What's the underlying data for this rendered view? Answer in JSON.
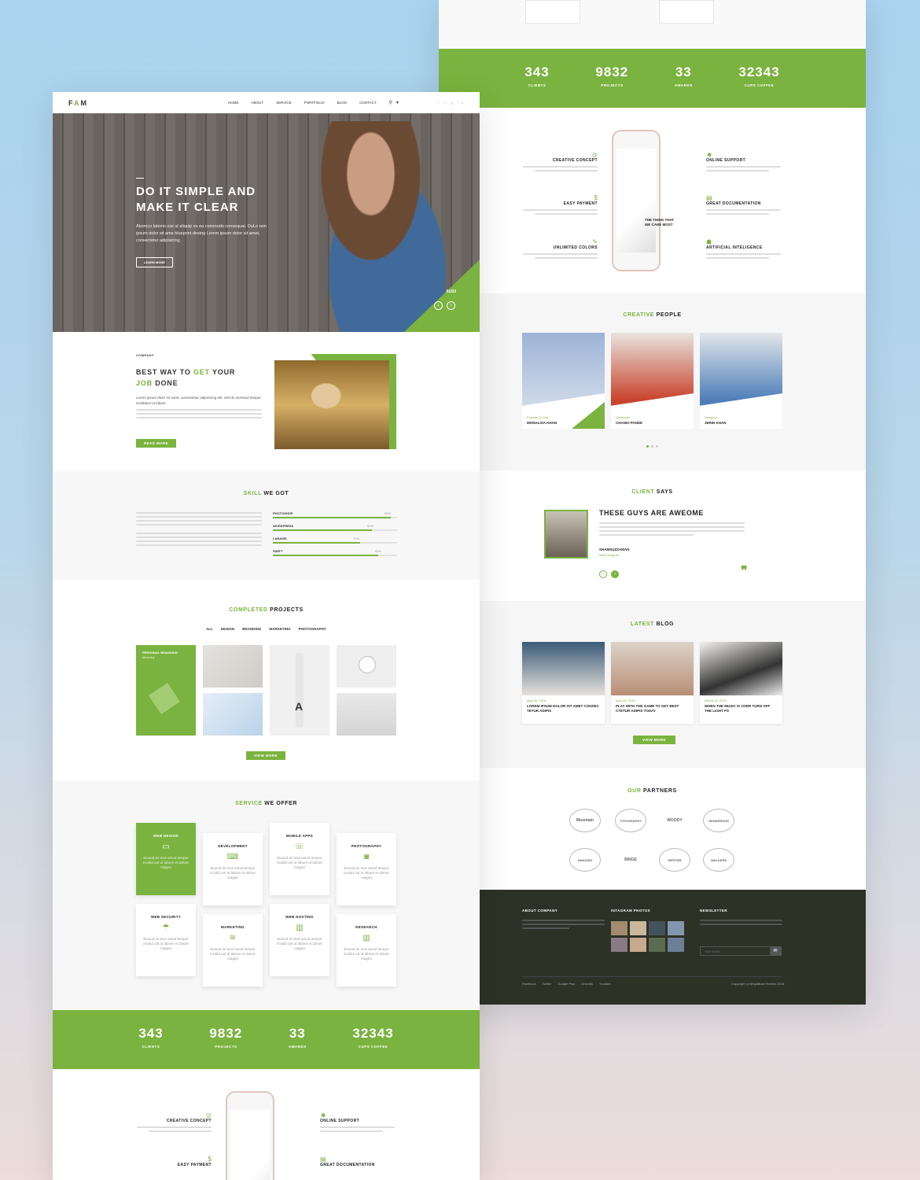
{
  "colors": {
    "accent": "#7ab33f",
    "footer": "#2c3226"
  },
  "counter": [
    {
      "num": "343",
      "label": "CLIENTS"
    },
    {
      "num": "9832",
      "label": "PROJECTS"
    },
    {
      "num": "33",
      "label": "AWARDS"
    },
    {
      "num": "32343",
      "label": "CUPS COFFEE"
    }
  ],
  "features": {
    "left": [
      {
        "title": "CREATIVE CONCEPT",
        "icon": "target-icon"
      },
      {
        "title": "EASY PAYMENT",
        "icon": "money-icon"
      },
      {
        "title": "UNLIMITED COLORS",
        "icon": "palette-icon"
      }
    ],
    "right": [
      {
        "title": "ONLINE SUPPORT",
        "icon": "support-icon"
      },
      {
        "title": "GREAT DOCUMENTATION",
        "icon": "document-icon"
      },
      {
        "title": "ARTIFICIAL INTELIGENCE",
        "icon": "robot-icon"
      }
    ],
    "phone_text": "THE THING THAT WE CARE MOST"
  },
  "people": {
    "title_accent": "CREATIVE",
    "title_rest": " PEOPLE",
    "members": [
      {
        "role": "Founder & Ceo",
        "name": "MONALISA KHAN"
      },
      {
        "role": "Developer",
        "name": "CHANKI PANDE"
      },
      {
        "role": "Designer",
        "name": "JERIN KHAN"
      }
    ]
  },
  "client": {
    "title_accent": "CLIENT",
    "title_rest": " SAYS",
    "heading": "THESE GUYS ARE AWEOME",
    "name": "SHAMSUZZAMAN",
    "role": "Web Designer"
  },
  "blog": {
    "title_accent": "LATEST",
    "title_rest": " BLOG",
    "posts": [
      {
        "date": "May 06, 2016",
        "title": "LOREM IPSUM DOLOR SIT AMET CONSEC TETUR ADIPIS"
      },
      {
        "date": "April 26, 2016",
        "title": "PLAY WITH THE GAME TO GET BEST CTETUR ADIPIS TODAY"
      },
      {
        "date": "March 16, 2016",
        "title": "WHEN THE MUSIC IS OVER TURN OFF THE LIGHT PS"
      }
    ],
    "button": "VIEW MORE"
  },
  "partners": {
    "title_accent": "OUR",
    "title_rest": " PARTNERS",
    "logos": [
      "Mountain",
      "TYPOGRAPHY",
      "WOODY",
      "HENDERSON",
      "AMAZING",
      "BINGE",
      "HIPSTER",
      "WALKERS"
    ]
  },
  "footer": {
    "about": "ABOUT COMPANY",
    "instagram": "INTAGRAM PHOTOS",
    "newsletter": "NEWSLETTER",
    "email_placeholder": "Your Email",
    "links": [
      "Facebook",
      "Twitter",
      "Google Plus",
      "Linkedin",
      "Youtube"
    ],
    "copyright": "Copyright (c) MayaBhai Themes 2016"
  },
  "nav": {
    "logo_f": "F",
    "logo_a": "A",
    "logo_m": "M",
    "items": [
      "HOME",
      "ABOUT",
      "SERVICE",
      "PORTFOLIO",
      "BLOG",
      "CONTACT"
    ]
  },
  "hero": {
    "title1": "DO IT SIMPLE AND",
    "title2": "MAKE IT CLEAR",
    "text": "Abomco laboris nisi ut aliquip ex ea commodo consequat. DuLo rem ipsum dolor sit ame blueprint desing Lorem ipsum dolor sit amet, consectetur adipisicing",
    "button": "LEARN MORE",
    "slide": "01/03"
  },
  "company": {
    "label": "COMPANY",
    "t1a": "BEST WAY TO ",
    "t1b": "GET",
    "t1c": " YOUR",
    "t2a": "JOB",
    "t2b": " DONE",
    "lead": "Lorem ipsum dolor sit amet, consectetur adipisicing elit, sed do eiusmod tempor incididunt ut labore",
    "button": "READ MORE"
  },
  "skills": {
    "title_accent": "SKILL",
    "title_rest": " WE GOT",
    "items": [
      {
        "label": "PHOTOSHOP",
        "pct": 95,
        "text": "95%"
      },
      {
        "label": "WORDPRESS",
        "pct": 80,
        "text": "80%"
      },
      {
        "label": "LARAVEL",
        "pct": 70,
        "text": "70%"
      },
      {
        "label": "SWIFT",
        "pct": 85,
        "text": "85%"
      }
    ]
  },
  "projects": {
    "title_accent": "COMPLETED",
    "title_rest": " PROJECTS",
    "tabs": [
      "ALL",
      "DESIGN",
      "BRANDING",
      "MARKETING",
      "PHOTOGRAPHY"
    ],
    "featured_title": "PERSONAL BRANDING",
    "featured_sub": "Marketing",
    "button": "VIEW MORE"
  },
  "services": {
    "title_accent": "SERVICE",
    "title_rest": " WE OFFER",
    "items": [
      {
        "title": "WEB DESIGN",
        "icon": "monitor-icon"
      },
      {
        "title": "DEVELOPMENT",
        "icon": "code-icon"
      },
      {
        "title": "MOBILE APPS",
        "icon": "mobile-icon"
      },
      {
        "title": "PHOTOGRAPHY",
        "icon": "camera-icon"
      },
      {
        "title": "WEB SECURITY",
        "icon": "umbrella-icon"
      },
      {
        "title": "MARKETING",
        "icon": "layers-icon"
      },
      {
        "title": "WEB HOSTING",
        "icon": "server-icon"
      },
      {
        "title": "RESEARCH",
        "icon": "chart-icon"
      }
    ],
    "desc": "Eiusod do eius amod tempor incidid unt ut labore et dolore magna"
  }
}
